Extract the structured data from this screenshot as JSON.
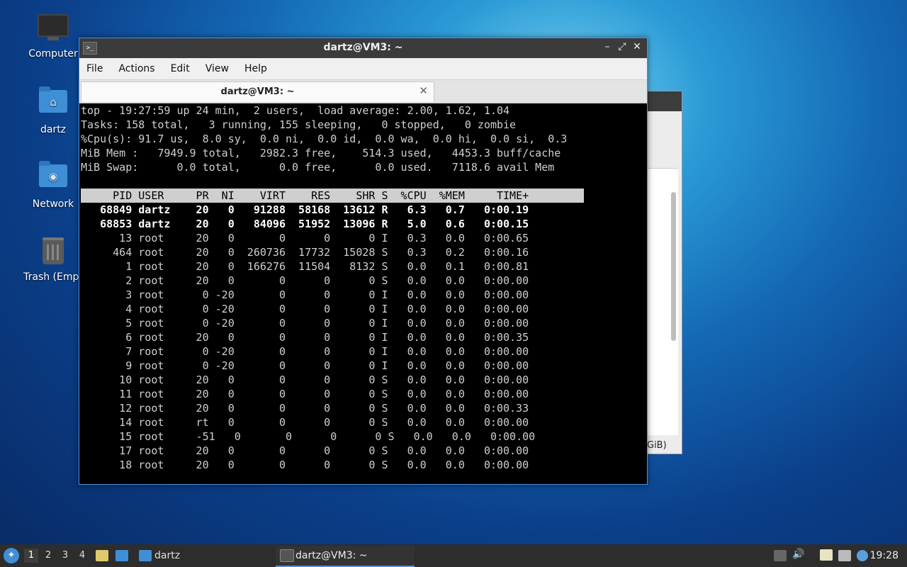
{
  "desktop": {
    "icons": [
      {
        "label": "Computer"
      },
      {
        "label": "dartz"
      },
      {
        "label": "Network"
      },
      {
        "label": "Trash (Empt"
      }
    ]
  },
  "background_window": {
    "fragment": "GiB)"
  },
  "terminal": {
    "title": "dartz@VM3: ~",
    "menu": [
      "File",
      "Actions",
      "Edit",
      "View",
      "Help"
    ],
    "tab_label": "dartz@VM3: ~",
    "summary": [
      "top - 19:27:59 up 24 min,  2 users,  load average: 2.00, 1.62, 1.04",
      "Tasks: 158 total,   3 running, 155 sleeping,   0 stopped,   0 zombie",
      "%Cpu(s): 91.7 us,  8.0 sy,  0.0 ni,  0.0 id,  0.0 wa,  0.0 hi,  0.0 si,  0.3",
      "MiB Mem :   7949.9 total,   2982.3 free,    514.3 used,   4453.3 buff/cache",
      "MiB Swap:      0.0 total,      0.0 free,      0.0 used.   7118.6 avail Mem"
    ],
    "columns": [
      "PID",
      "USER",
      "PR",
      "NI",
      "VIRT",
      "RES",
      "SHR",
      "S",
      "%CPU",
      "%MEM",
      "TIME+"
    ],
    "processes": [
      [
        "68849",
        "dartz",
        "20",
        "0",
        "91288",
        "58168",
        "13612",
        "R",
        "6.3",
        "0.7",
        "0:00.19"
      ],
      [
        "68853",
        "dartz",
        "20",
        "0",
        "84096",
        "51952",
        "13096",
        "R",
        "5.0",
        "0.6",
        "0:00.15"
      ],
      [
        "13",
        "root",
        "20",
        "0",
        "0",
        "0",
        "0",
        "I",
        "0.3",
        "0.0",
        "0:00.65"
      ],
      [
        "464",
        "root",
        "20",
        "0",
        "260736",
        "17732",
        "15028",
        "S",
        "0.3",
        "0.2",
        "0:00.16"
      ],
      [
        "1",
        "root",
        "20",
        "0",
        "166276",
        "11504",
        "8132",
        "S",
        "0.0",
        "0.1",
        "0:00.81"
      ],
      [
        "2",
        "root",
        "20",
        "0",
        "0",
        "0",
        "0",
        "S",
        "0.0",
        "0.0",
        "0:00.00"
      ],
      [
        "3",
        "root",
        "0",
        "-20",
        "0",
        "0",
        "0",
        "I",
        "0.0",
        "0.0",
        "0:00.00"
      ],
      [
        "4",
        "root",
        "0",
        "-20",
        "0",
        "0",
        "0",
        "I",
        "0.0",
        "0.0",
        "0:00.00"
      ],
      [
        "5",
        "root",
        "0",
        "-20",
        "0",
        "0",
        "0",
        "I",
        "0.0",
        "0.0",
        "0:00.00"
      ],
      [
        "6",
        "root",
        "20",
        "0",
        "0",
        "0",
        "0",
        "I",
        "0.0",
        "0.0",
        "0:00.35"
      ],
      [
        "7",
        "root",
        "0",
        "-20",
        "0",
        "0",
        "0",
        "I",
        "0.0",
        "0.0",
        "0:00.00"
      ],
      [
        "9",
        "root",
        "0",
        "-20",
        "0",
        "0",
        "0",
        "I",
        "0.0",
        "0.0",
        "0:00.00"
      ],
      [
        "10",
        "root",
        "20",
        "0",
        "0",
        "0",
        "0",
        "S",
        "0.0",
        "0.0",
        "0:00.00"
      ],
      [
        "11",
        "root",
        "20",
        "0",
        "0",
        "0",
        "0",
        "S",
        "0.0",
        "0.0",
        "0:00.00"
      ],
      [
        "12",
        "root",
        "20",
        "0",
        "0",
        "0",
        "0",
        "S",
        "0.0",
        "0.0",
        "0:00.33"
      ],
      [
        "14",
        "root",
        "rt",
        "0",
        "0",
        "0",
        "0",
        "S",
        "0.0",
        "0.0",
        "0:00.00"
      ],
      [
        "15",
        "root",
        "-51",
        "0",
        "0",
        "0",
        "0",
        "S",
        "0.0",
        "0.0",
        "0:00.00"
      ],
      [
        "17",
        "root",
        "20",
        "0",
        "0",
        "0",
        "0",
        "S",
        "0.0",
        "0.0",
        "0:00.00"
      ],
      [
        "18",
        "root",
        "20",
        "0",
        "0",
        "0",
        "0",
        "S",
        "0.0",
        "0.0",
        "0:00.00"
      ]
    ],
    "bold_rows": 2
  },
  "taskbar": {
    "workspaces": [
      "1",
      "2",
      "3",
      "4"
    ],
    "active_workspace": "1",
    "folder_label": "dartz",
    "task_label": "dartz@VM3: ~",
    "clock": "19:28"
  }
}
